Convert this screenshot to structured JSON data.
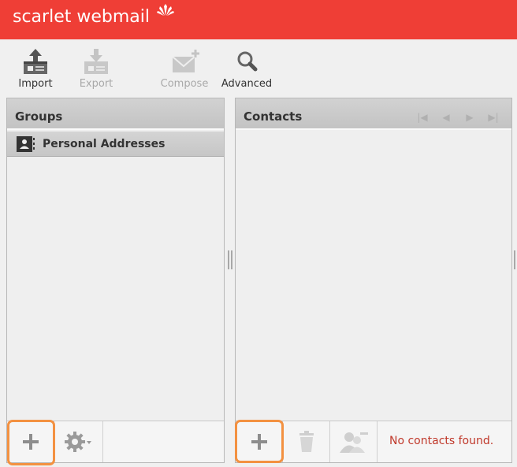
{
  "header": {
    "brand": "scarlet webmail"
  },
  "toolbar": {
    "import_label": "Import",
    "export_label": "Export",
    "compose_label": "Compose",
    "advanced_label": "Advanced"
  },
  "groups": {
    "title": "Groups",
    "items": [
      {
        "label": "Personal Addresses"
      }
    ]
  },
  "contacts": {
    "title": "Contacts",
    "empty_message": "No contacts found."
  },
  "icons": {
    "brand_mark": "sparkle-icon",
    "import": "import-icon",
    "export": "export-icon",
    "compose": "compose-icon",
    "advanced": "search-icon",
    "group_item": "address-book-icon",
    "add": "plus-icon",
    "settings": "gear-icon",
    "delete": "trash-icon",
    "remove_from_group": "user-minus-icon",
    "nav": [
      "first-page-icon",
      "prev-page-icon",
      "next-page-icon",
      "last-page-icon"
    ]
  },
  "colors": {
    "brand": "#ef3e36",
    "highlight": "#f39141",
    "message": "#c0392b"
  }
}
